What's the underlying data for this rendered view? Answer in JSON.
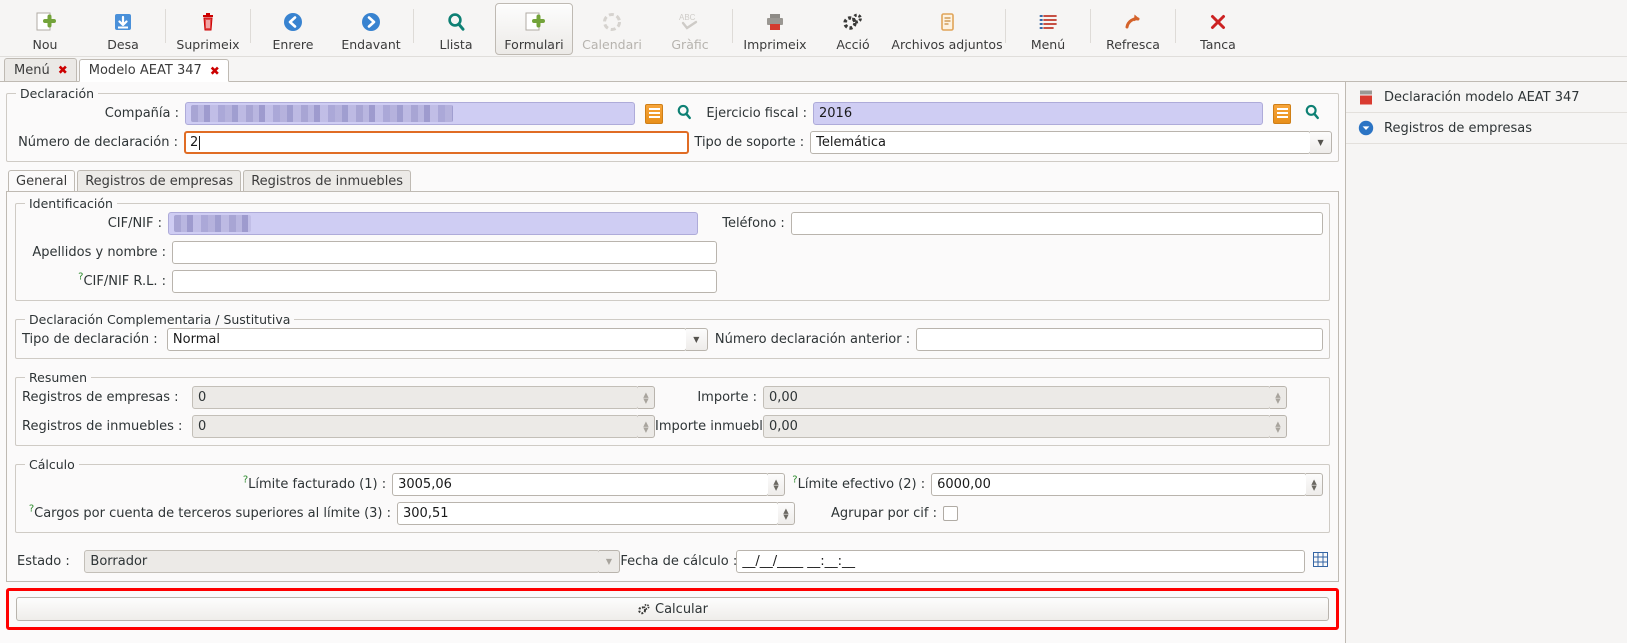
{
  "toolbar": {
    "items": [
      {
        "label": "Nou",
        "icon": "new-document-plus-icon",
        "state": "enabled"
      },
      {
        "label": "Desa",
        "icon": "save-download-icon",
        "state": "enabled"
      },
      {
        "label": "Suprimeix",
        "icon": "trash-delete-icon",
        "state": "enabled"
      },
      {
        "label": "Enrere",
        "icon": "arrow-back-icon",
        "state": "enabled"
      },
      {
        "label": "Endavant",
        "icon": "arrow-forward-icon",
        "state": "enabled"
      },
      {
        "label": "Llista",
        "icon": "search-list-icon",
        "state": "enabled"
      },
      {
        "label": "Formulari",
        "icon": "form-plus-icon",
        "state": "active"
      },
      {
        "label": "Calendari",
        "icon": "calendar-icon",
        "state": "disabled"
      },
      {
        "label": "Gràfic",
        "icon": "abc-chart-icon",
        "state": "disabled"
      },
      {
        "label": "Imprimeix",
        "icon": "printer-icon",
        "state": "enabled"
      },
      {
        "label": "Acció",
        "icon": "gears-action-icon",
        "state": "enabled"
      },
      {
        "label": "Archivos adjuntos",
        "icon": "attachment-clipboard-icon",
        "state": "enabled"
      },
      {
        "label": "Menú",
        "icon": "menu-list-icon",
        "state": "enabled"
      },
      {
        "label": "Refresca",
        "icon": "refresh-arrow-icon",
        "state": "enabled"
      },
      {
        "label": "Tanca",
        "icon": "close-x-icon",
        "state": "enabled"
      }
    ]
  },
  "window_tabs": [
    {
      "label": "Menú",
      "close": "✖",
      "selected": false
    },
    {
      "label": "Modelo AEAT 347",
      "close": "✖",
      "selected": true
    }
  ],
  "declaration": {
    "legend": "Declaración",
    "compania_label": "Compañía :",
    "compania_value": "",
    "compania_redacted": true,
    "ejercicio_label": "Ejercicio fiscal :",
    "ejercicio_value": "2016",
    "numero_label": "Número de declaración :",
    "numero_value": "2",
    "tipo_soporte_label": "Tipo de soporte :",
    "tipo_soporte_value": "Telemática"
  },
  "inner_tabs": [
    {
      "label": "General",
      "selected": true
    },
    {
      "label": "Registros de empresas",
      "selected": false
    },
    {
      "label": "Registros de inmuebles",
      "selected": false
    }
  ],
  "identificacion": {
    "legend": "Identificación",
    "cif_label": "CIF/NIF :",
    "cif_value": "",
    "cif_redacted": true,
    "telefono_label": "Teléfono :",
    "telefono_value": "",
    "apellidos_label": "Apellidos y nombre :",
    "apellidos_value": "",
    "cif_rl_label": "CIF/NIF R.L. :",
    "cif_rl_help": "?",
    "cif_rl_value": ""
  },
  "complementaria": {
    "legend": "Declaración Complementaria / Sustitutiva",
    "tipo_label": "Tipo de declaración :",
    "tipo_value": "Normal",
    "numero_anterior_label": "Número declaración anterior :",
    "numero_anterior_value": ""
  },
  "resumen": {
    "legend": "Resumen",
    "registros_empresas_label": "Registros de empresas :",
    "registros_empresas_value": "0",
    "importe_label": "Importe :",
    "importe_value": "0,00",
    "registros_inmuebles_label": "Registros de inmuebles :",
    "registros_inmuebles_value": "0",
    "importe_inmuebles_label": "Importe inmuebles :",
    "importe_inmuebles_value": "0,00"
  },
  "calculo": {
    "legend": "Cálculo",
    "help_mark": "?",
    "limite_facturado_label": "Límite facturado (1) :",
    "limite_facturado_value": "3005,06",
    "limite_efectivo_label": "Límite efectivo (2) :",
    "limite_efectivo_value": "6000,00",
    "cargos_label": "Cargos por cuenta de terceros superiores al límite (3) :",
    "cargos_value": "300,51",
    "agrupar_label": "Agrupar por cif :",
    "agrupar_checked": false
  },
  "footer": {
    "estado_label": "Estado :",
    "estado_value": "Borrador",
    "fecha_label": "Fecha de cálculo :",
    "fecha_value": "__/__/____  __:__:__",
    "grid_icon": "grid-picker-icon",
    "calcular_label": "Calcular",
    "calcular_icon": "gears-calc-icon",
    "highlight_color": "#ff0000"
  },
  "sidebar": {
    "items": [
      {
        "label": "Declaración modelo AEAT 347",
        "icon": "red-record-icon"
      },
      {
        "label": "Registros de empresas",
        "icon": "blue-down-badge-icon"
      }
    ]
  }
}
